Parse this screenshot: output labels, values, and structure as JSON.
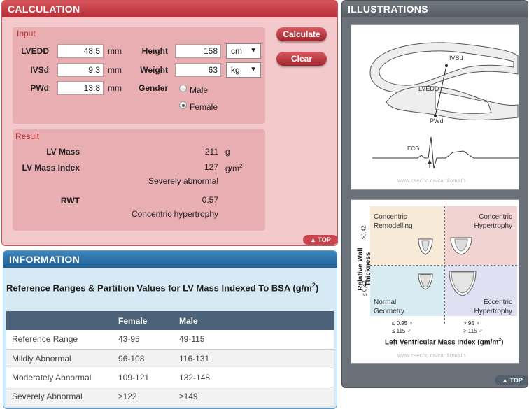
{
  "calculation": {
    "title": "CALCULATION",
    "input_label": "Input",
    "lvedd": {
      "label": "LVEDD",
      "value": "48.5",
      "unit": "mm"
    },
    "ivsd": {
      "label": "IVSd",
      "value": "9.3",
      "unit": "mm"
    },
    "pwd": {
      "label": "PWd",
      "value": "13.8",
      "unit": "mm"
    },
    "height": {
      "label": "Height",
      "value": "158",
      "unit": "cm"
    },
    "weight": {
      "label": "Weight",
      "value": "63",
      "unit": "kg"
    },
    "gender": {
      "label": "Gender",
      "options": [
        "Male",
        "Female"
      ],
      "selected": "Female"
    },
    "calculate_button": "Calculate",
    "clear_button": "Clear",
    "result_label": "Result",
    "lv_mass": {
      "label": "LV Mass",
      "value": "211",
      "unit": "g"
    },
    "lv_mass_index": {
      "label": "LV Mass Index",
      "value": "127",
      "unit": "g/m",
      "interpretation": "Severely abnormal"
    },
    "rwt": {
      "label": "RWT",
      "value": "0.57",
      "interpretation": "Concentric hypertrophy"
    },
    "top_button": "TOP"
  },
  "information": {
    "title": "INFORMATION",
    "heading": "Reference Ranges & Partition Values for LV Mass Indexed To BSA (g/m",
    "heading_end": ")",
    "columns": [
      "",
      "Female",
      "Male"
    ],
    "rows": [
      [
        "Reference Range",
        "43-95",
        "49-115"
      ],
      [
        "Mildly Abnormal",
        "96-108",
        "116-131"
      ],
      [
        "Moderately Abnormal",
        "109-121",
        "132-148"
      ],
      [
        "Severely Abnormal",
        "≥122",
        "≥149"
      ]
    ]
  },
  "illustrations": {
    "title": "ILLUSTRATIONS",
    "diagram": {
      "ivsd": "IVSd",
      "lvedd": "LVEDD",
      "pwd": "PWd",
      "ecg": "ECG",
      "credit": "www.csecho.ca/cardiomath"
    },
    "quadrants": {
      "top_left": "Concentric Remodelling",
      "top_right": "Concentric Hypertrophy",
      "bottom_left": "Normal Geometry",
      "bottom_right": "Eccentric Hypertrophy",
      "y_axis": "Relative Wall Thickness",
      "y_high": ">0.42",
      "y_low": "≤ 0.42",
      "x_left_1": "≤ 0.95",
      "x_left_2": "≤ 115",
      "x_right_1": "> 95",
      "x_right_2": "> 115",
      "x_axis": "Left Ventricular Mass Index (gm/m",
      "x_axis_end": ")",
      "credit": "www.csecho.ca/cardiomath"
    },
    "top_button": "TOP"
  },
  "colors": {
    "calc_accent": "#b72f37",
    "info_accent": "#1d5f96",
    "illus_accent": "#555c62"
  }
}
